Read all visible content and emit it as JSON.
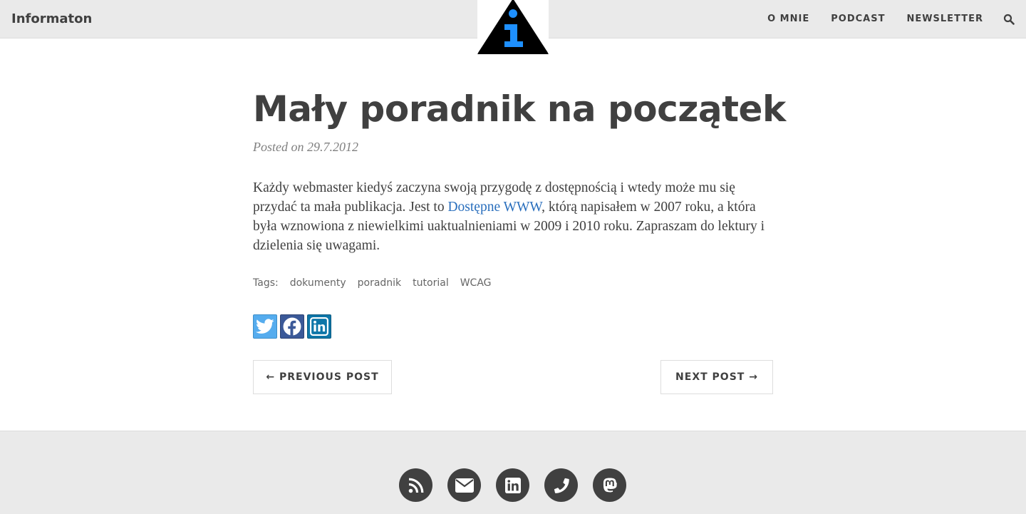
{
  "navbar": {
    "brand": "Informaton",
    "links": [
      "O MNIE",
      "PODCAST",
      "NEWSLETTER"
    ],
    "logo_icon": "info-triangle-logo",
    "search_icon": "search-icon"
  },
  "post": {
    "title": "Mały poradnik na początek",
    "meta": "Posted on 29.7.2012",
    "body_before_link": "Każdy webmaster kiedyś zaczyna swoją przygodę z dostępnością i wtedy może mu się przydać ta mała publikacja. Jest to ",
    "link_text": "Dostępne WWW",
    "body_after_link": ", którą napisałem w 2007 roku, a która była wznowiona z niewielkimi uaktualnieniami w 2009 i 2010 roku. Zapraszam do lektury i dzielenia się uwagami.",
    "tags_label": "Tags:",
    "tags": [
      "dokumenty",
      "poradnik",
      "tutorial",
      "WCAG"
    ]
  },
  "share": {
    "icons": [
      "twitter-icon",
      "facebook-icon",
      "linkedin-icon"
    ]
  },
  "pager": {
    "previous": "← PREVIOUS POST",
    "next": "NEXT POST →"
  },
  "footer": {
    "icons": [
      "rss-icon",
      "envelope-icon",
      "linkedin-icon",
      "phone-icon",
      "mastodon-icon"
    ]
  },
  "colors": {
    "navbar_bg": "#eaeaea",
    "text": "#404040",
    "link": "#2a6fbd",
    "logo_blue": "#1e90ff",
    "twitter": "#55acee",
    "facebook": "#3b5998",
    "linkedin": "#0e76a8"
  }
}
